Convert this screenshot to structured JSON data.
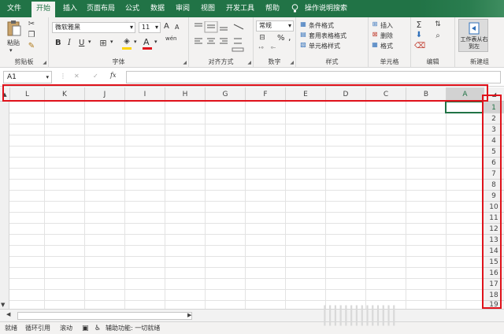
{
  "tabs": [
    {
      "label": "文件"
    },
    {
      "label": "开始"
    },
    {
      "label": "插入"
    },
    {
      "label": "页面布局"
    },
    {
      "label": "公式"
    },
    {
      "label": "数据"
    },
    {
      "label": "审阅"
    },
    {
      "label": "视图"
    },
    {
      "label": "开发工具"
    },
    {
      "label": "帮助"
    },
    {
      "label": "操作说明搜索"
    }
  ],
  "active_tab": "开始",
  "ribbon": {
    "clipboard": {
      "paste": "粘贴",
      "label": "剪贴板"
    },
    "font": {
      "name": "微软雅黑",
      "size": "11",
      "label": "字体",
      "bold": "B",
      "italic": "I",
      "underline": "U",
      "grow": "A",
      "shrink": "A",
      "color_a": "A",
      "wen": "wén"
    },
    "alignment": {
      "label": "对齐方式"
    },
    "number": {
      "format": "常规",
      "percent": "%",
      "comma": ",",
      "label": "数字"
    },
    "styles": {
      "conditional": "条件格式",
      "table": "套用表格格式",
      "cell": "单元格样式",
      "label": "样式"
    },
    "cells": {
      "insert": "插入",
      "delete": "删除",
      "format": "格式",
      "label": "单元格"
    },
    "editing": {
      "label": "编辑"
    },
    "new_group": {
      "button": "工作表从右到左",
      "label": "新建组"
    }
  },
  "formula_bar": {
    "name_box": "A1",
    "fx": "fx",
    "cancel": "✕",
    "enter": "✓"
  },
  "columns": [
    "L",
    "K",
    "J",
    "I",
    "H",
    "G",
    "F",
    "E",
    "D",
    "C",
    "B",
    "A"
  ],
  "rows": [
    "1",
    "2",
    "3",
    "4",
    "5",
    "6",
    "7",
    "8",
    "9",
    "10",
    "11",
    "12",
    "13",
    "14",
    "15",
    "16",
    "17",
    "18",
    "19"
  ],
  "selected_cell": "A1",
  "status": {
    "ready": "就绪",
    "circular": "循环引用",
    "scroll": "滚动",
    "accessibility": "辅助功能: 一切就绪"
  },
  "watermark": "||||||||||||||",
  "colors": {
    "accent": "#217346",
    "highlight": "#e0121b",
    "font_color_bar": "#e0121b",
    "fill_bar": "#ffd400"
  }
}
